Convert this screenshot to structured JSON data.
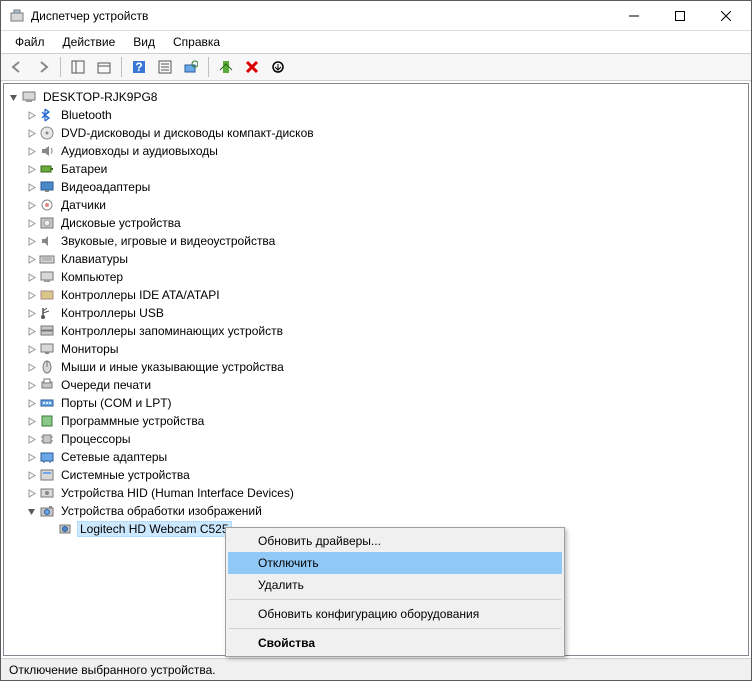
{
  "window": {
    "title": "Диспетчер устройств"
  },
  "winbuttons": {
    "min": "—",
    "max": "▢",
    "close": "✕"
  },
  "menu": {
    "file": "Файл",
    "action": "Действие",
    "view": "Вид",
    "help": "Справка"
  },
  "root": {
    "name": "DESKTOP-RJK9PG8"
  },
  "categories": [
    {
      "label": "Bluetooth",
      "icon": "bt"
    },
    {
      "label": "DVD-дисководы и дисководы компакт-дисков",
      "icon": "dvd"
    },
    {
      "label": "Аудиовходы и аудиовыходы",
      "icon": "audio"
    },
    {
      "label": "Батареи",
      "icon": "battery"
    },
    {
      "label": "Видеоадаптеры",
      "icon": "display"
    },
    {
      "label": "Датчики",
      "icon": "sensor"
    },
    {
      "label": "Дисковые устройства",
      "icon": "disk"
    },
    {
      "label": "Звуковые, игровые и видеоустройства",
      "icon": "sound"
    },
    {
      "label": "Клавиатуры",
      "icon": "keyboard"
    },
    {
      "label": "Компьютер",
      "icon": "pc"
    },
    {
      "label": "Контроллеры IDE ATA/ATAPI",
      "icon": "ide"
    },
    {
      "label": "Контроллеры USB",
      "icon": "usb"
    },
    {
      "label": "Контроллеры запоминающих устройств",
      "icon": "storage"
    },
    {
      "label": "Мониторы",
      "icon": "monitor"
    },
    {
      "label": "Мыши и иные указывающие устройства",
      "icon": "mouse"
    },
    {
      "label": "Очереди печати",
      "icon": "print"
    },
    {
      "label": "Порты (COM и LPT)",
      "icon": "port"
    },
    {
      "label": "Программные устройства",
      "icon": "soft"
    },
    {
      "label": "Процессоры",
      "icon": "cpu"
    },
    {
      "label": "Сетевые адаптеры",
      "icon": "net"
    },
    {
      "label": "Системные устройства",
      "icon": "sys"
    },
    {
      "label": "Устройства HID (Human Interface Devices)",
      "icon": "hid"
    },
    {
      "label": "Устройства обработки изображений",
      "icon": "imaging",
      "expanded": true,
      "children": [
        {
          "label": "Logitech HD Webcam C525",
          "icon": "webcam",
          "selected": true
        }
      ]
    }
  ],
  "context": {
    "items": [
      {
        "label": "Обновить драйверы..."
      },
      {
        "label": "Отключить",
        "hover": true
      },
      {
        "label": "Удалить"
      },
      {
        "sep": true
      },
      {
        "label": "Обновить конфигурацию оборудования"
      },
      {
        "sep": true
      },
      {
        "label": "Свойства",
        "bold": true
      }
    ]
  },
  "status": {
    "text": "Отключение выбранного устройства."
  }
}
